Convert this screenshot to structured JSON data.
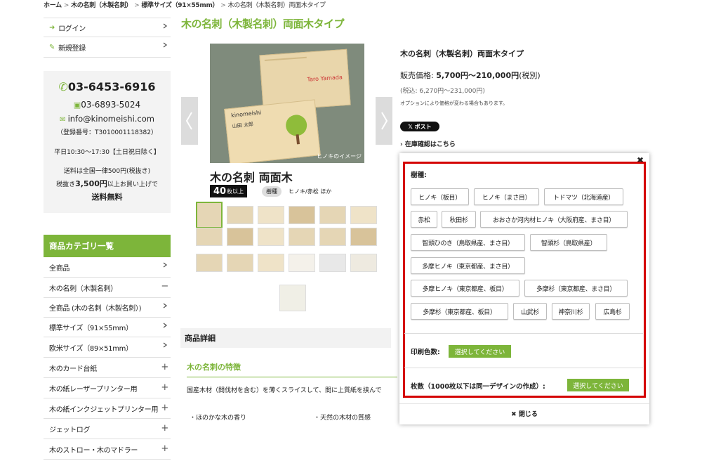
{
  "breadcrumb": {
    "home": "ホーム",
    "cat": "木の名刺（木製名刺）",
    "sub": "標準サイズ（91×55mm）",
    "current": "木の名刺（木製名刺）両面木タイプ"
  },
  "sidebar": {
    "login": "ログイン",
    "register": "新規登録",
    "phone": "03-6453-6916",
    "fax": "03-6893-5024",
    "email": "info@kinomeishi.com",
    "reg": "（登録番号：T3010001118382）",
    "hours": "平日10:30～17:30【土日祝日除く】",
    "ship1": "送料は全国一律500円(税抜き)",
    "ship2_pre": "税抜き",
    "ship2_amt": "3,500円",
    "ship2_post": "以上お買い上げで",
    "ship3": "送料無料",
    "cat_title": "商品カテゴリ一覧",
    "items": [
      "全商品",
      "木の名刺（木製名刺）",
      "全商品 (木の名刺（木製名刺）)",
      "標準サイズ（91×55mm）",
      "欧米サイズ（89×51mm）",
      "木のカード台紙",
      "木の紙レーザープリンター用",
      "木の紙インクジェットプリンター用",
      "ジェットログ",
      "木のストロー・木のマドラー"
    ]
  },
  "product": {
    "title": "木の名刺（木製名刺）両面木タイプ",
    "img_caption": "ヒノキのイメージ",
    "card_name": "山田 太郎",
    "card_name_en": "Taro Yamada",
    "card_logo": "kinomeishi",
    "name": "木の名刺 両面木",
    "qty": "40",
    "qty_unit": "枚以上",
    "tag": "樹種",
    "tag_value": "ヒノキ/赤松 ほか",
    "info_title": "木の名刺（木製名刺）両面木タイプ",
    "price_label": "販売価格: ",
    "price": "5,700円～210,000円",
    "price_suffix": "(税別)",
    "tax_price": "(税込: 6,270円～231,000円)",
    "opt_note": "オプションにより価格が変わる場合もあります。",
    "xpost": "𝕏 ポスト",
    "stock": "› 在庫確認はこちら"
  },
  "popup": {
    "species_label": "樹種:",
    "species": [
      "ヒノキ（板目）",
      "ヒノキ（まさ目）",
      "トドマツ（北海道産）",
      "赤松",
      "秋田杉",
      "おおさか河内材ヒノキ（大阪府産、まさ目）",
      "智頭ひのき（鳥取県産、まさ目）",
      "智頭杉（鳥取県産）",
      "多摩ヒノキ（東京都産、まさ目）",
      "多摩ヒノキ（東京都産、板目）",
      "多摩杉（東京都産、まさ目）",
      "多摩杉（東京都産、板目）",
      "山武杉",
      "神奈川杉",
      "広島杉"
    ],
    "color_label": "印刷色数:",
    "select": "選択してください",
    "qty_label": "枚数（1000枚以下は同一デザインの作成）:",
    "close": "閉じる"
  },
  "details": {
    "head": "商品詳細",
    "feature": "木の名刺の特徴",
    "desc": "国産木材（間伐材を含む）を薄くスライスして、間に上質紙を挟んで",
    "b1": "・ほのかな木の香り",
    "b2": "・天然の木材の質感"
  },
  "colors": {
    "accent": "#7db53a",
    "highlight": "#d40000"
  }
}
